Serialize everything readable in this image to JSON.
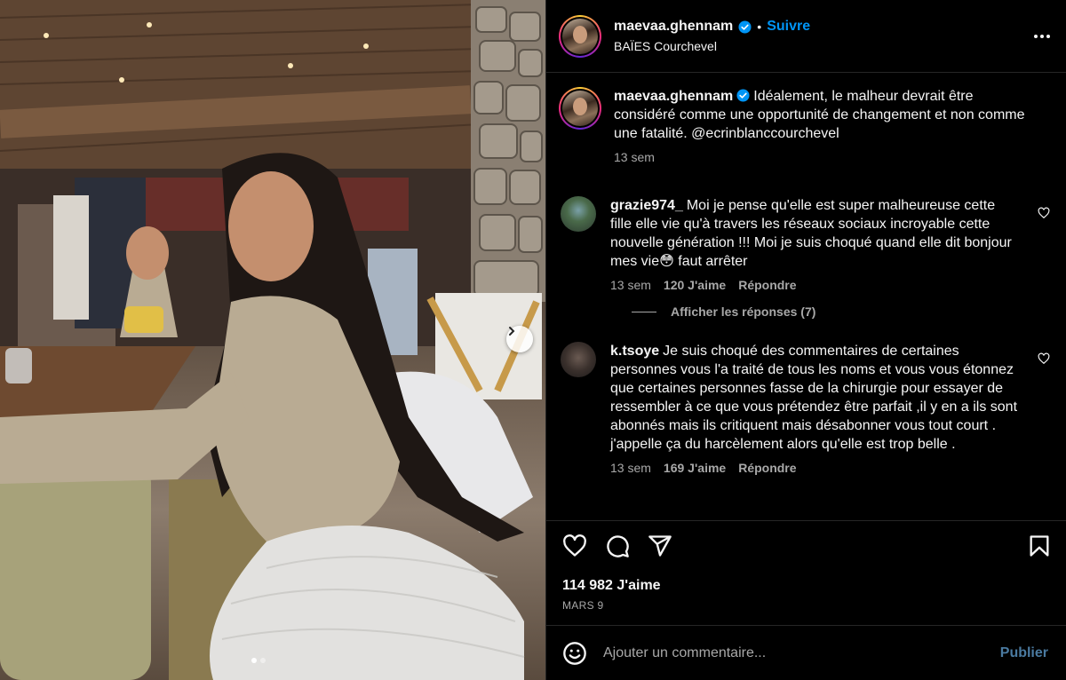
{
  "header": {
    "username": "maevaa.ghennam",
    "separator": "•",
    "follow_label": "Suivre",
    "location": "BAÏES Courchevel"
  },
  "caption": {
    "username": "maevaa.ghennam",
    "text": "Idéalement, le malheur devrait être considéré comme une opportunité de changement et non comme une fatalité. @ecrinblanccourchevel",
    "time": "13 sem"
  },
  "comments": [
    {
      "username": "grazie974_",
      "text": "Moi je pense qu'elle est super malheureuse cette fille elle vie qu'à travers les réseaux sociaux incroyable cette nouvelle génération !!! Moi je suis choqué quand elle dit bonjour mes vie😳 faut arrêter",
      "time": "13 sem",
      "likes": "120 J'aime",
      "reply_label": "Répondre",
      "view_replies": "Afficher les réponses (7)"
    },
    {
      "username": "k.tsoye",
      "text": "Je suis choqué des commentaires de certaines personnes vous l'a traité de tous les noms et vous vous étonnez que certaines personnes fasse de la chirurgie pour essayer de ressembler à ce que vous prétendez être parfait ,il y en a ils sont abonnés mais ils critiquent mais désabonner vous tout court . j'appelle ça du harcèlement alors qu'elle est trop belle .",
      "time": "13 sem",
      "likes": "169 J'aime",
      "reply_label": "Répondre"
    }
  ],
  "post": {
    "likes": "114 982 J'aime",
    "date": "MARS 9"
  },
  "composer": {
    "placeholder": "Ajouter un commentaire...",
    "publish_label": "Publier"
  },
  "icons": {
    "like": "heart-icon",
    "comment": "comment-bubble-icon",
    "share": "paper-plane-icon",
    "save": "bookmark-icon",
    "more": "ellipsis-icon",
    "emoji": "smiley-icon",
    "verified": "verified-badge-icon",
    "next": "chevron-right-icon"
  },
  "colors": {
    "background": "#000000",
    "text": "#f5f5f5",
    "secondary_text": "#a8a8a8",
    "link_blue": "#0095f6",
    "divider": "#262626"
  }
}
